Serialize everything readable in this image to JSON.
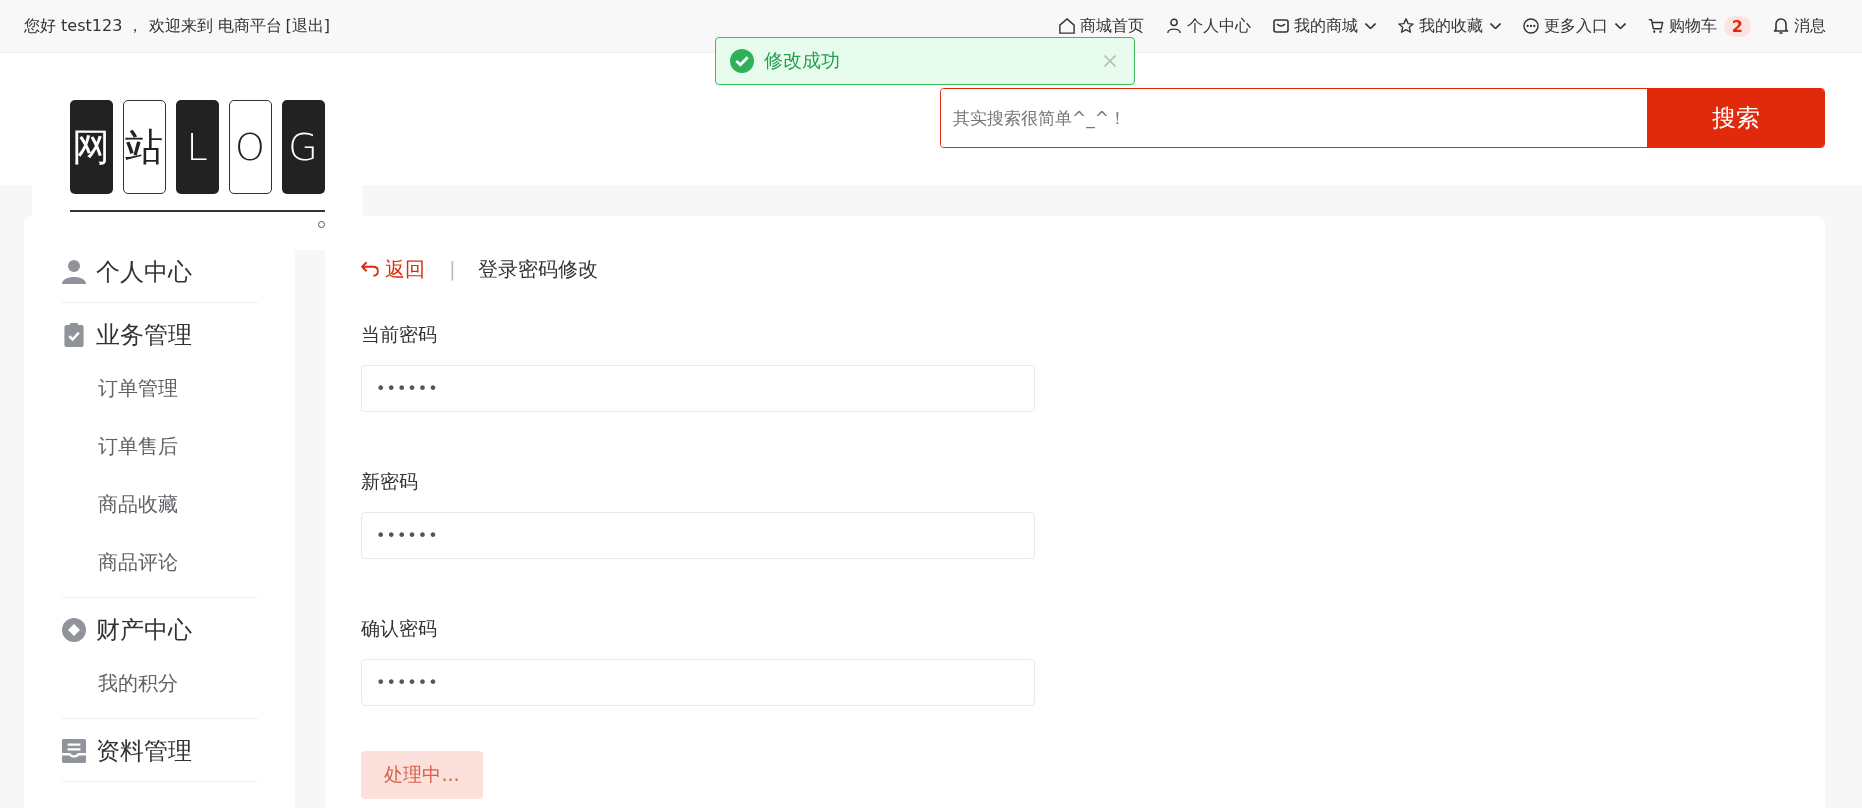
{
  "top_bar": {
    "greeting": "您好 test123 ， 欢迎来到 电商平台",
    "logout": "[退出]",
    "nav": [
      {
        "label": "商城首页",
        "dropdown": false
      },
      {
        "label": "个人中心",
        "dropdown": false
      },
      {
        "label": "我的商城",
        "dropdown": true
      },
      {
        "label": "我的收藏",
        "dropdown": true
      },
      {
        "label": "更多入口",
        "dropdown": true
      },
      {
        "label": "购物车",
        "dropdown": false,
        "badge": "2"
      },
      {
        "label": "消息",
        "dropdown": false
      }
    ]
  },
  "toast": {
    "kind": "success",
    "message": "修改成功"
  },
  "logo": {
    "letters": [
      {
        "char": "网",
        "dark": true
      },
      {
        "char": "站",
        "dark": false
      },
      {
        "char": "L",
        "dark": true
      },
      {
        "char": "O",
        "dark": false
      },
      {
        "char": "G",
        "dark": true
      }
    ]
  },
  "search": {
    "placeholder": "其实搜索很简单^_^！",
    "button": "搜索"
  },
  "sidebar": {
    "groups": [
      {
        "label": "个人中心"
      },
      {
        "label": "业务管理",
        "children": [
          {
            "label": "订单管理",
            "selected": false
          },
          {
            "label": "订单售后",
            "selected": false
          },
          {
            "label": "商品收藏",
            "selected": false
          },
          {
            "label": "商品评论",
            "selected": false
          }
        ]
      },
      {
        "label": "财产中心",
        "children": [
          {
            "label": "我的积分",
            "selected": false
          }
        ]
      },
      {
        "label": "资料管理"
      }
    ]
  },
  "page": {
    "back": "返回",
    "separator": "|",
    "title": "登录密码修改",
    "fields": [
      {
        "label": "当前密码",
        "value": "••••••"
      },
      {
        "label": "新密码",
        "value": "••••••"
      },
      {
        "label": "确认密码",
        "value": "••••••"
      }
    ],
    "submit": {
      "label": "处理中...",
      "disabled": true
    }
  }
}
